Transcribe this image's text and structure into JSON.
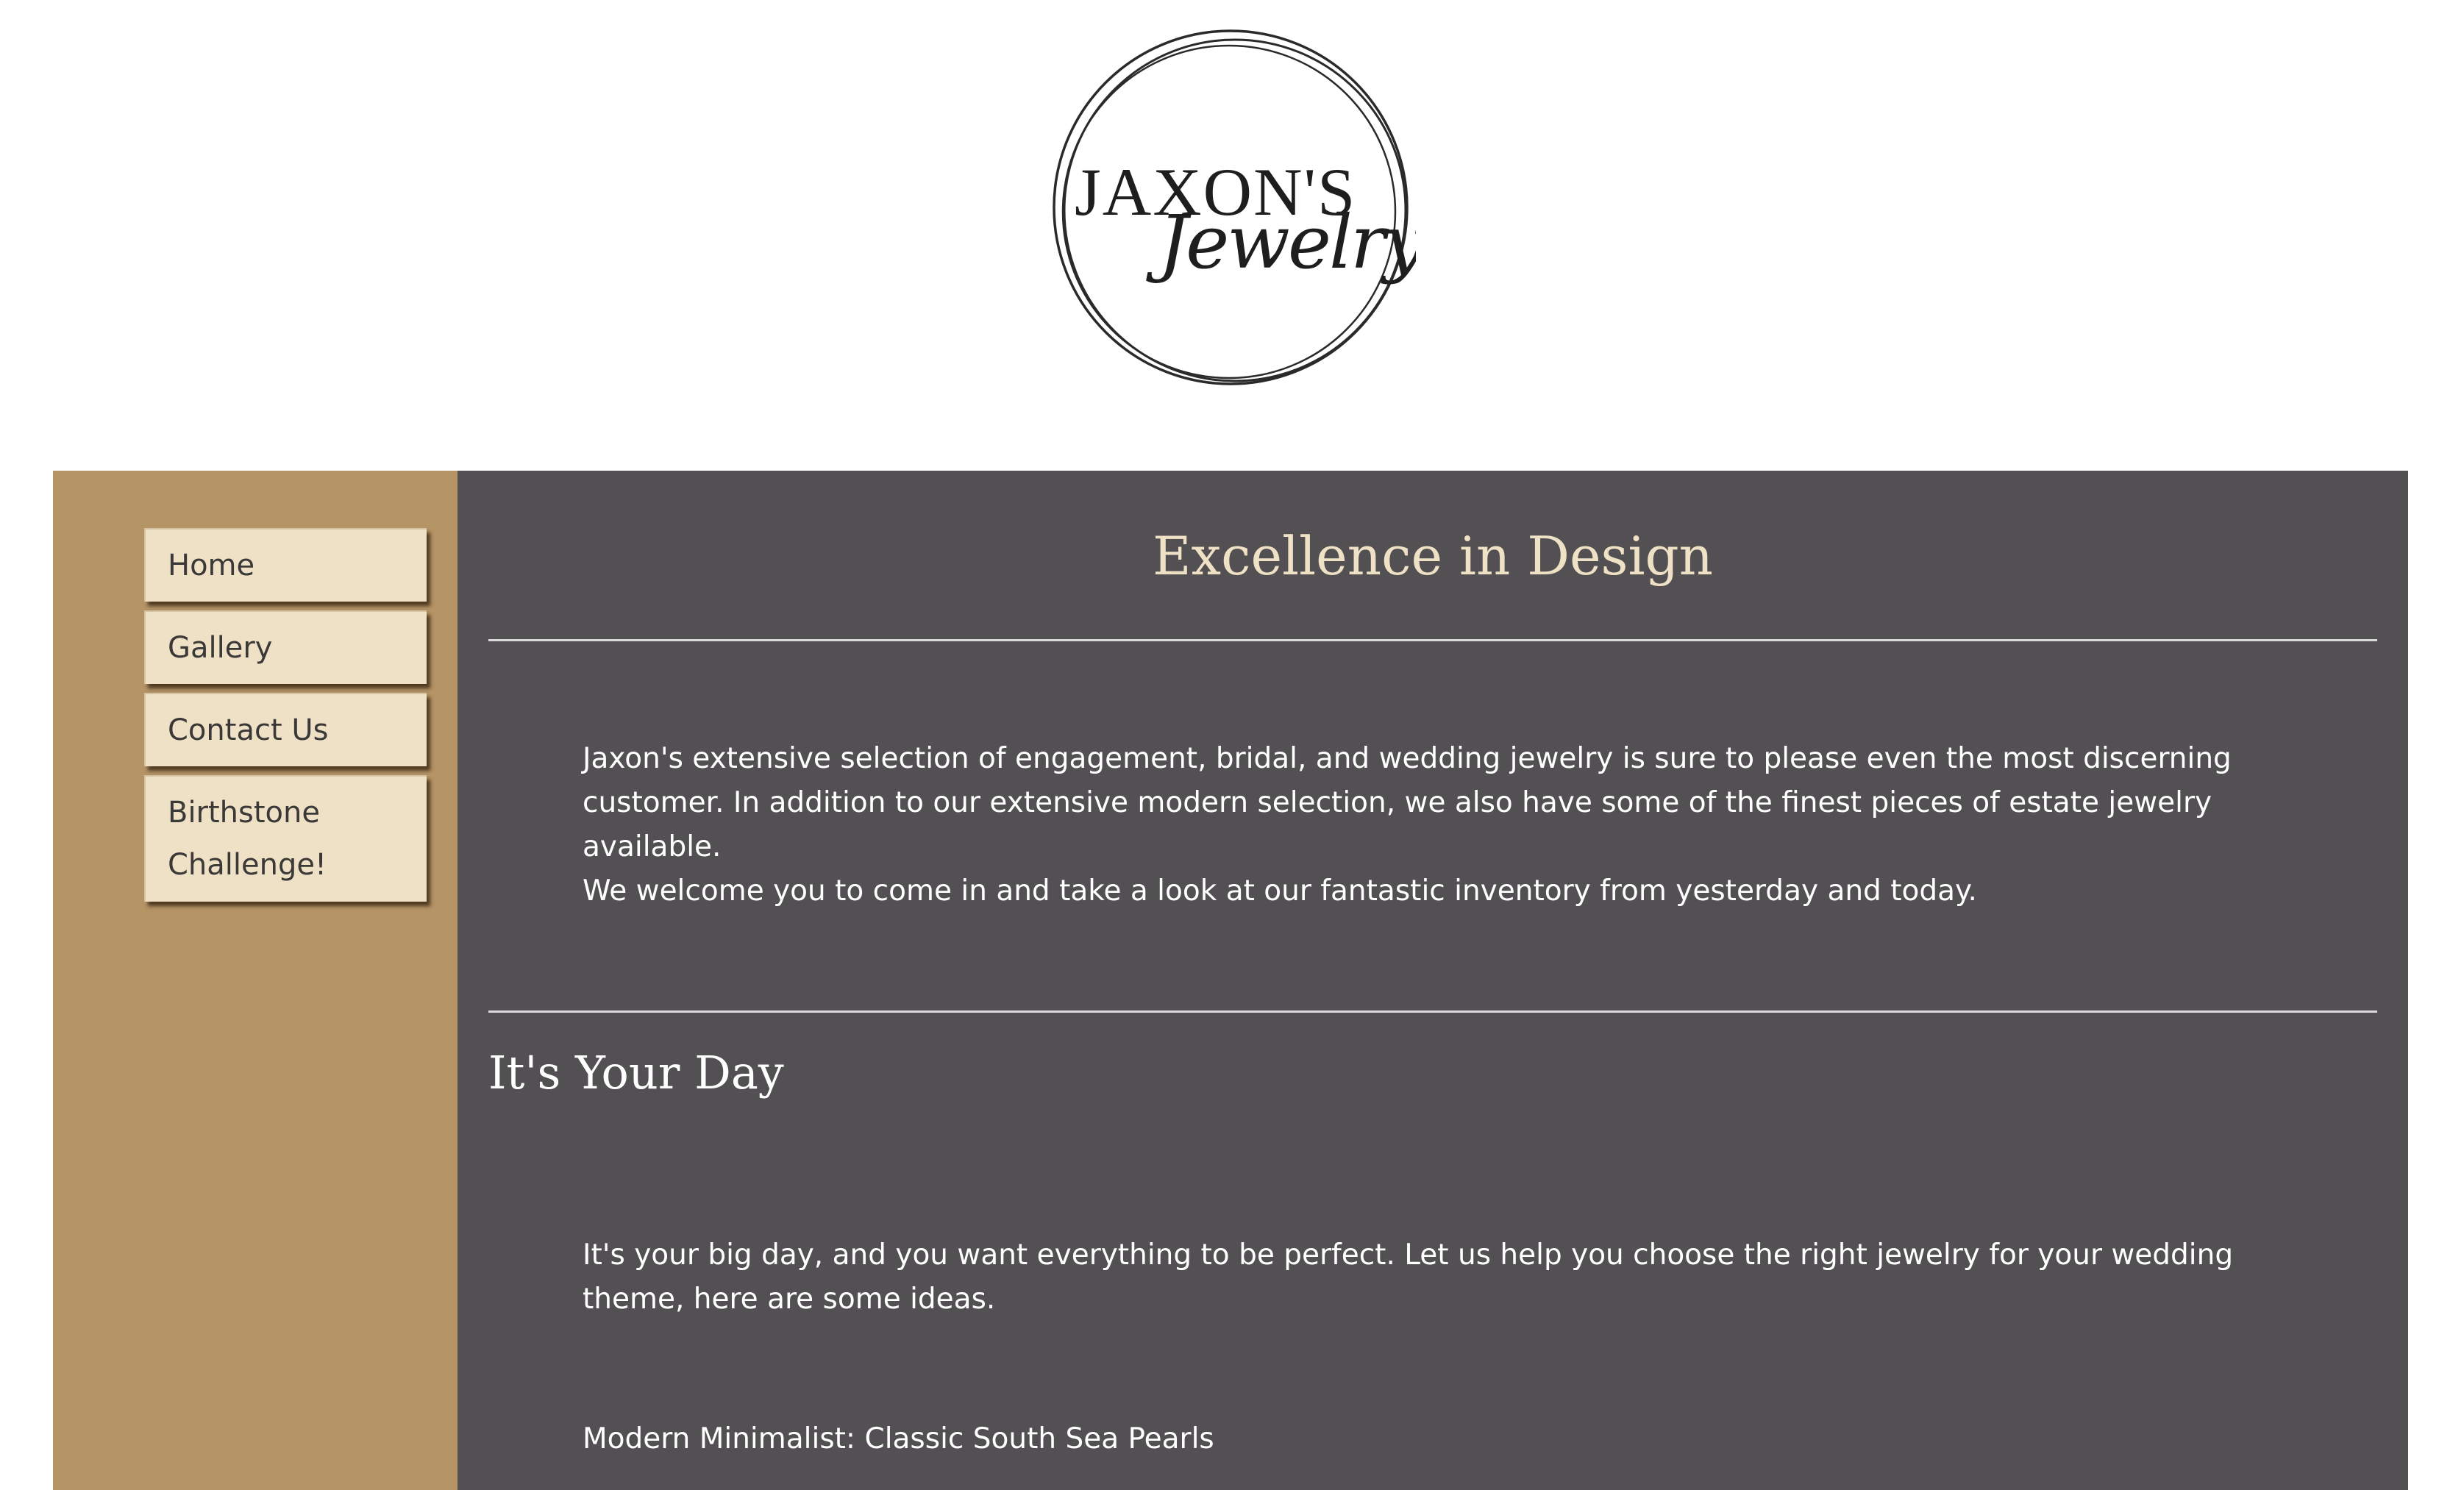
{
  "logo": {
    "main_text": "JAXON'S",
    "script_text": "Jewelry"
  },
  "nav": {
    "items": [
      {
        "label": "Home"
      },
      {
        "label": "Gallery"
      },
      {
        "label": "Contact Us"
      },
      {
        "label_line1": "Birthstone",
        "label_line2": "Challenge!"
      }
    ]
  },
  "main": {
    "title": "Excellence in Design",
    "intro_paragraphs": [
      "Jaxon's extensive selection of engagement, bridal, and wedding jewelry is sure to please even the most discerning customer. In addition to our extensive modern selection, we also have some of the finest pieces of estate jewelry available.",
      "We welcome you to come in and take a look at our fantastic inventory from yesterday and today."
    ],
    "section": {
      "title": "It's Your Day",
      "paragraph": "It's your big day, and you want everything to be perfect. Let us help you choose the right jewelry for your wedding theme, here are some ideas.",
      "idea": "Modern Minimalist: Classic South Sea Pearls"
    }
  },
  "colors": {
    "sidebar": "#b59466",
    "content_bg": "#525052",
    "nav_button": "#efe1c5",
    "title": "#efe1c5",
    "text": "#ffffff"
  }
}
